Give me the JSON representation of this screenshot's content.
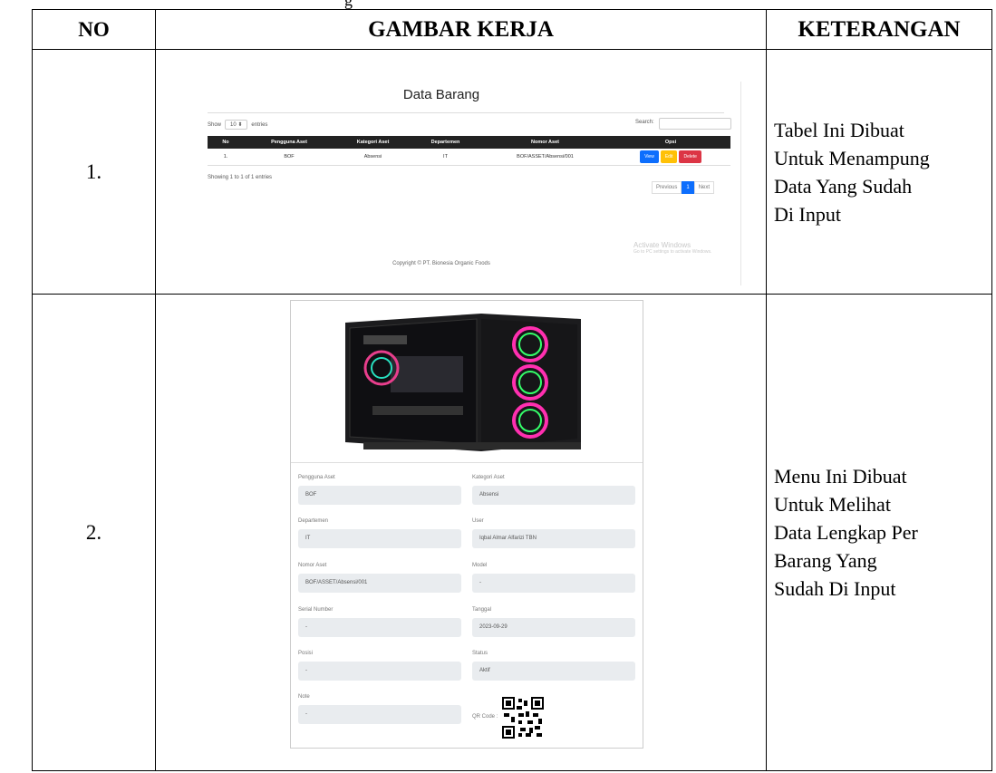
{
  "header": {
    "no": "NO",
    "gambar": "GAMBAR KERJA",
    "keterangan": "KETERANGAN"
  },
  "caption_fragment": "g",
  "rows": [
    {
      "no": "1.",
      "keterangan": [
        "Tabel Ini Dibuat",
        "Untuk Menampung",
        "Data Yang Sudah",
        "Di Input"
      ]
    },
    {
      "no": "2.",
      "keterangan": [
        "Menu Ini Dibuat",
        "Untuk Melihat",
        "Data Lengkap Per",
        "Barang Yang",
        "Sudah Di Input"
      ]
    }
  ],
  "screenshot1": {
    "title": "Data Barang",
    "show_label": "Show",
    "show_value": "10",
    "entries_label": "entries",
    "search_label": "Search:",
    "columns": [
      "No",
      "Pengguna Aset",
      "Kategori Aset",
      "Departemen",
      "Nomor Aset",
      "Opsi"
    ],
    "row": {
      "no": "1.",
      "pengguna": "BOF",
      "kategori": "Absensi",
      "departemen": "IT",
      "nomor": "BOF/ASSET/Absensi/001"
    },
    "buttons": {
      "view": "View",
      "edit": "Edit",
      "delete": "Delete"
    },
    "button_colors": {
      "view": "#0d6efd",
      "edit": "#ffc107",
      "delete": "#dc3545"
    },
    "showing": "Showing 1 to 1 of 1 entries",
    "pager": {
      "prev": "Previous",
      "page": "1",
      "next": "Next"
    },
    "watermark_title": "Activate Windows",
    "watermark_sub": "Go to PC settings to activate Windows.",
    "copyright": "Copyright © PT. Bionesia Organic Foods"
  },
  "screenshot2": {
    "fields": {
      "pengguna_label": "Pengguna Aset",
      "pengguna_value": "BOF",
      "kategori_label": "Kategori Aset",
      "kategori_value": "Absensi",
      "departemen_label": "Departemen",
      "departemen_value": "IT",
      "user_label": "User",
      "user_value": "Iqbal Almar Alfarizi TBN",
      "nomor_label": "Nomor Aset",
      "nomor_value": "BOF/ASSET/Absensi/001",
      "model_label": "Model",
      "model_value": "-",
      "serial_label": "Serial Number",
      "serial_value": "-",
      "tanggal_label": "Tanggal",
      "tanggal_value": "2023-09-29",
      "posisi_label": "Posisi",
      "posisi_value": "-",
      "status_label": "Status",
      "status_value": "Aktif",
      "note_label": "Note",
      "note_value": "-",
      "qr_label": "QR Code :"
    }
  }
}
